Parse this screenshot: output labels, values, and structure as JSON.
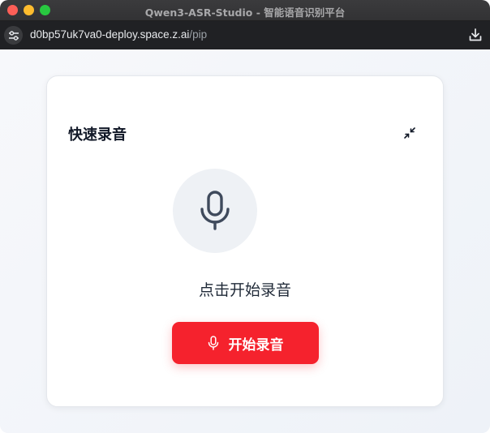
{
  "window": {
    "title": "Qwen3-ASR-Studio - 智能语音识别平台"
  },
  "address_bar": {
    "url_host": "d0bp57uk7va0-deploy.space.z.ai",
    "url_path": "/pip"
  },
  "card": {
    "title": "快速录音",
    "prompt": "点击开始录音",
    "record_button_label": "开始录音"
  },
  "colors": {
    "accent_red": "#f5222d",
    "mic_circle_bg": "#eef1f5",
    "mic_icon": "#3f4a5c"
  },
  "icons": {
    "collapse": "collapse-arrows-icon",
    "mic_large": "microphone-icon",
    "mic_button": "microphone-icon",
    "site_settings": "sliders-icon",
    "download": "download-icon"
  }
}
